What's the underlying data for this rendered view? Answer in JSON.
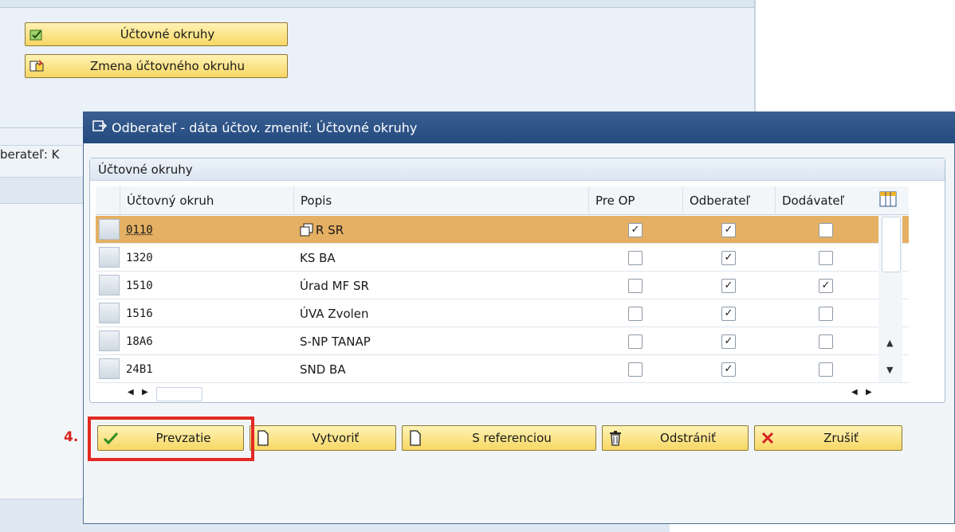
{
  "background": {
    "buttons": [
      {
        "label": "Účtovné okruhy",
        "icon": "green-check-stamp-icon"
      },
      {
        "label": "Zmena účtovného okruhu",
        "icon": "change-layout-icon"
      }
    ],
    "side_label": "berateľ: K"
  },
  "dialog": {
    "title": "Odberateľ - dáta účtov. zmeniť: Účtovné okruhy",
    "group_title": "Účtovné okruhy",
    "columns": [
      "Účtovný okruh",
      "Popis",
      "Pre OP",
      "Odberateľ",
      "Dodávateľ"
    ],
    "rows": [
      {
        "code": "0110",
        "description": "R SR",
        "pre_op": true,
        "odberatel": true,
        "dodavatel": false,
        "selected": true
      },
      {
        "code": "1320",
        "description": "KS BA",
        "pre_op": false,
        "odberatel": true,
        "dodavatel": false,
        "selected": false
      },
      {
        "code": "1510",
        "description": "Úrad MF SR",
        "pre_op": false,
        "odberatel": true,
        "dodavatel": true,
        "selected": false
      },
      {
        "code": "1516",
        "description": "ÚVA Zvolen",
        "pre_op": false,
        "odberatel": true,
        "dodavatel": false,
        "selected": false
      },
      {
        "code": "18A6",
        "description": "S-NP TANAP",
        "pre_op": false,
        "odberatel": true,
        "dodavatel": false,
        "selected": false
      },
      {
        "code": "24B1",
        "description": "SND BA",
        "pre_op": false,
        "odberatel": true,
        "dodavatel": false,
        "selected": false
      }
    ],
    "buttons": {
      "accept": "Prevzatie",
      "create": "Vytvoriť",
      "with_reference": "S referenciou",
      "delete": "Odstrániť",
      "cancel": "Zrušiť"
    }
  },
  "annotation": {
    "step": "4."
  },
  "colors": {
    "title_bar": "#2b5288",
    "selected_row": "#e5b063",
    "button": "#f7d764",
    "highlight": "#e32922"
  }
}
